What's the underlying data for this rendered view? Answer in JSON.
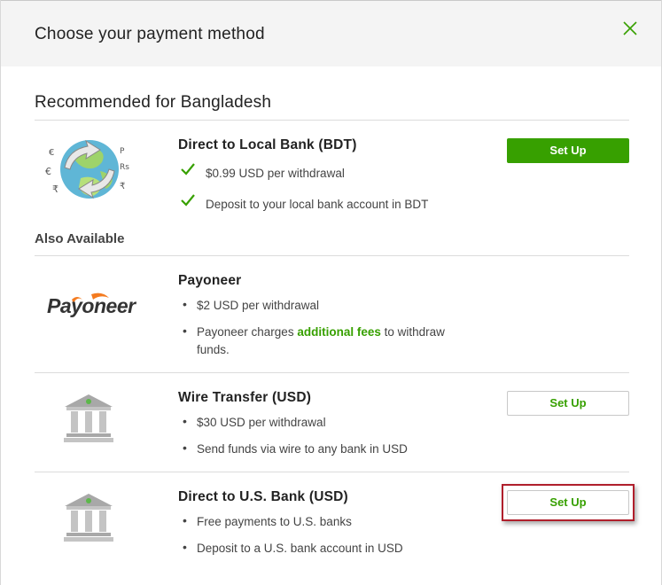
{
  "modal": {
    "title": "Choose your payment method"
  },
  "recommended": {
    "heading": "Recommended for Bangladesh",
    "method": {
      "title": "Direct to Local Bank (BDT)",
      "features": [
        "$0.99 USD per withdrawal",
        "Deposit to your local bank account in BDT"
      ],
      "button_label": "Set Up",
      "logo_icon": "currency-globe-icon"
    }
  },
  "also_available": {
    "heading": "Also Available",
    "methods": [
      {
        "title": "Payoneer",
        "logo_text": "Payoneer",
        "features": [
          "$2 USD per withdrawal"
        ],
        "fee_note": {
          "prefix": "Payoneer charges ",
          "link": "additional fees",
          "suffix": " to withdraw",
          "continuation": "funds."
        }
      },
      {
        "title": "Wire Transfer (USD)",
        "features": [
          "$30 USD per withdrawal",
          "Send funds via wire to any bank in USD"
        ],
        "button_label": "Set Up",
        "logo_icon": "bank-building-icon"
      },
      {
        "title": "Direct to U.S. Bank (USD)",
        "features": [
          "Free payments to U.S. banks",
          "Deposit to a U.S. bank account in USD"
        ],
        "button_label": "Set Up",
        "logo_icon": "bank-building-icon"
      }
    ]
  },
  "colors": {
    "accent": "#37a000",
    "highlight": "#b01f2c",
    "header_bg": "#f4f4f4"
  }
}
